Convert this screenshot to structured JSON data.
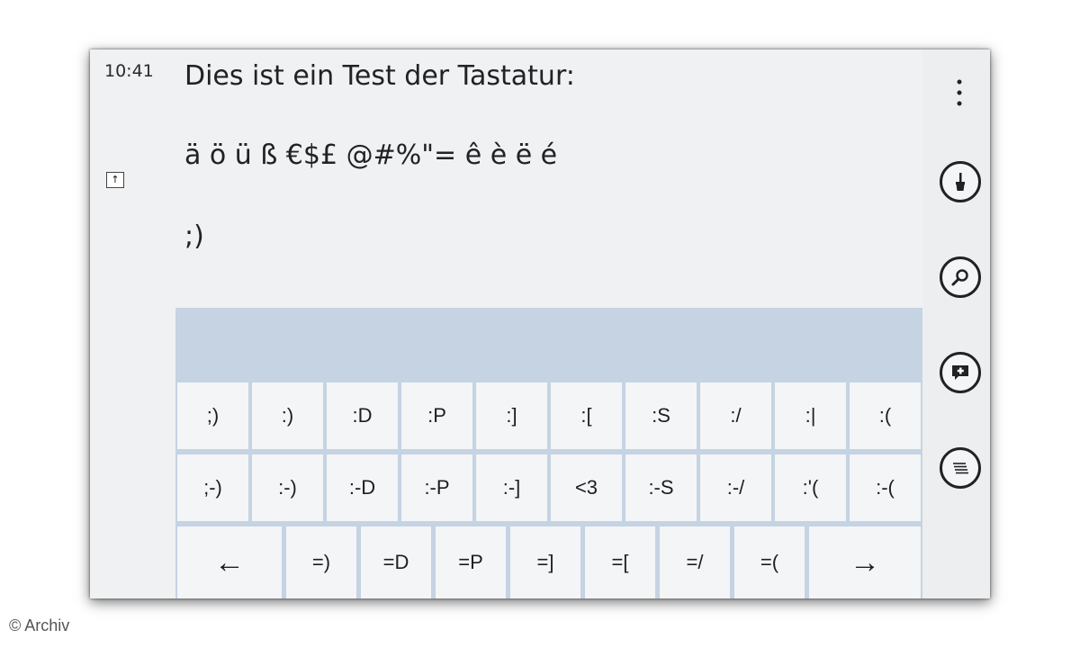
{
  "status": {
    "time": "10:41"
  },
  "editor": {
    "caps_indicator": "↑",
    "lines": [
      "Dies ist ein Test der Tastatur:",
      "ä ö ü ß €$£ @#%\"= ê è ë é",
      ";)"
    ]
  },
  "appbar": {
    "more_label": "⋮",
    "buttons": [
      {
        "icon": "brush-icon"
      },
      {
        "icon": "search-icon"
      },
      {
        "icon": "comment-add-icon"
      },
      {
        "icon": "list-icon"
      }
    ]
  },
  "keyboard": {
    "row1": [
      ";)",
      ":)",
      ":D",
      ":P",
      ":]",
      ":[",
      ":S",
      ":/",
      ":|",
      ":("
    ],
    "row2": [
      ";-)",
      ":-)",
      ":-D",
      ":-P",
      ":-]",
      "<3",
      ":-S",
      ":-/",
      ":'(",
      ":-("
    ],
    "row3": [
      "=)",
      "=D",
      "=P",
      "=]",
      "=[",
      "=/",
      "=("
    ],
    "back_arrow": "←",
    "forward_arrow": "→"
  },
  "watermark": "© Archiv"
}
